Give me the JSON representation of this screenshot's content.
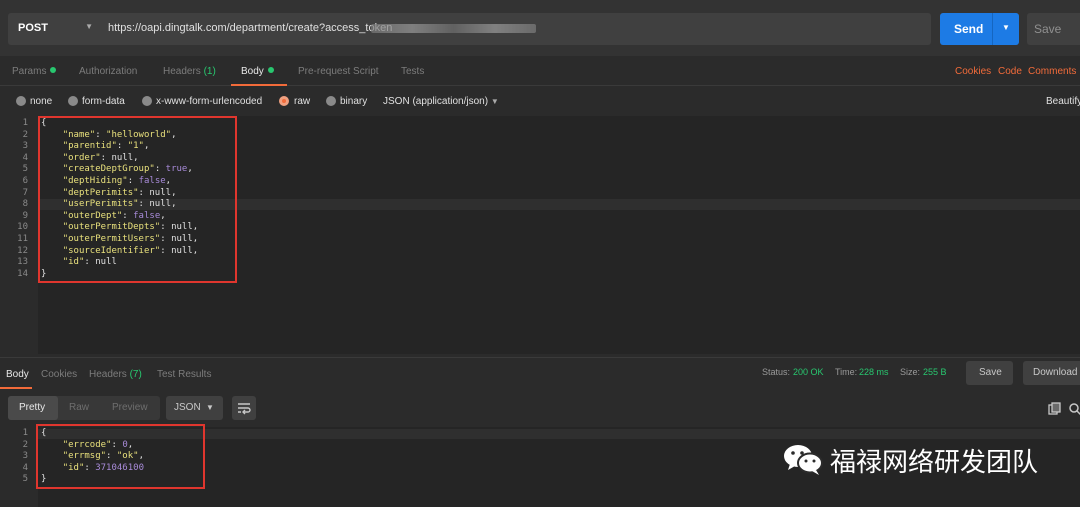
{
  "request": {
    "method": "POST",
    "url": "https://oapi.dingtalk.com/department/create?access_token",
    "send_label": "Send",
    "save_label": "Save"
  },
  "request_tabs": {
    "params": "Params",
    "authorization": "Authorization",
    "headers": "Headers",
    "headers_count": "(1)",
    "body": "Body",
    "prerequest": "Pre-request Script",
    "tests": "Tests",
    "cookies": "Cookies",
    "code": "Code",
    "comments": "Comments"
  },
  "body_types": {
    "none": "none",
    "form_data": "form-data",
    "urlencoded": "x-www-form-urlencoded",
    "raw": "raw",
    "binary": "binary",
    "content_type": "JSON (application/json)",
    "beautify": "Beautify"
  },
  "request_body": {
    "line_numbers": [
      "1",
      "2",
      "3",
      "4",
      "5",
      "6",
      "7",
      "8",
      "9",
      "10",
      "11",
      "12",
      "13",
      "14"
    ],
    "open": "{",
    "close": "}",
    "fields": [
      {
        "key": "\"name\"",
        "value": "\"helloworld\"",
        "comma": ","
      },
      {
        "key": "\"parentid\"",
        "value": "\"1\"",
        "comma": ","
      },
      {
        "key": "\"order\"",
        "value": "null",
        "comma": ","
      },
      {
        "key": "\"createDeptGroup\"",
        "value": "true",
        "comma": ","
      },
      {
        "key": "\"deptHiding\"",
        "value": "false",
        "comma": ","
      },
      {
        "key": "\"deptPerimits\"",
        "value": "null",
        "comma": ","
      },
      {
        "key": "\"userPerimits\"",
        "value": "null",
        "comma": ","
      },
      {
        "key": "\"outerDept\"",
        "value": "false",
        "comma": ","
      },
      {
        "key": "\"outerPermitDepts\"",
        "value": "null",
        "comma": ","
      },
      {
        "key": "\"outerPermitUsers\"",
        "value": "null",
        "comma": ","
      },
      {
        "key": "\"sourceIdentifier\"",
        "value": "null",
        "comma": ","
      },
      {
        "key": "\"id\"",
        "value": "null",
        "comma": ""
      }
    ]
  },
  "response_tabs": {
    "body": "Body",
    "cookies": "Cookies",
    "headers": "Headers",
    "headers_count": "(7)",
    "test_results": "Test Results",
    "status_label": "Status:",
    "status_value": "200 OK",
    "time_label": "Time:",
    "time_value": "228 ms",
    "size_label": "Size:",
    "size_value": "255 B",
    "save": "Save",
    "download": "Download"
  },
  "response_toolbar": {
    "pretty": "Pretty",
    "raw": "Raw",
    "preview": "Preview",
    "format": "JSON"
  },
  "response_body": {
    "line_numbers": [
      "1",
      "2",
      "3",
      "4",
      "5"
    ],
    "open": "{",
    "close": "}",
    "fields": [
      {
        "key": "\"errcode\"",
        "value": "0",
        "comma": ","
      },
      {
        "key": "\"errmsg\"",
        "value": "\"ok\"",
        "comma": ","
      },
      {
        "key": "\"id\"",
        "value": "371046100",
        "comma": ""
      }
    ]
  },
  "watermark": {
    "text": "福禄网络研发团队",
    "icon": "wechat-icon"
  },
  "colors": {
    "accent": "#f26b3a",
    "send": "#1d7be5",
    "success": "#28c76f",
    "highlight_box": "#e0362e"
  }
}
